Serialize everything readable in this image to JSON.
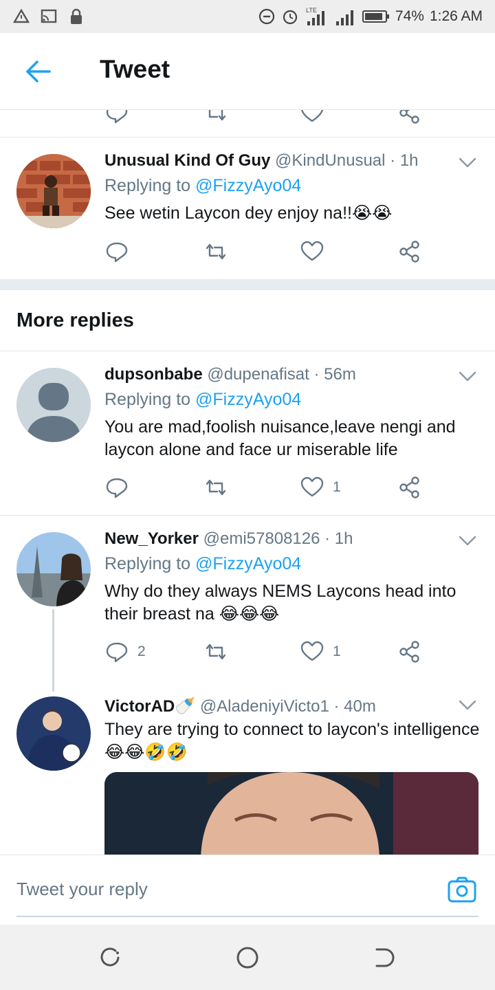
{
  "status_bar": {
    "battery": "74%",
    "time": "1:26 AM",
    "network": "LTE"
  },
  "header": {
    "title": "Tweet"
  },
  "tweets": [
    {
      "name": "Unusual Kind Of Guy",
      "handle": "@KindUnusual",
      "time": "· 1h",
      "replying_prefix": "Replying to",
      "replying_handle": "@FizzyAyo04",
      "text": "See wetin Laycon dey enjoy na!!😭😭",
      "replies": "",
      "likes": ""
    }
  ],
  "section": {
    "title": "More replies"
  },
  "more_replies": [
    {
      "name": "dupsonbabe",
      "handle": "@dupenafisat",
      "time": "· 56m",
      "replying_prefix": "Replying to",
      "replying_handle": "@FizzyAyo04",
      "text": "You are mad,foolish nuisance,leave nengi and laycon alone and face ur miserable life",
      "replies": "",
      "likes": "1"
    },
    {
      "name": "New_Yorker",
      "handle": "@emi57808126",
      "time": "· 1h",
      "replying_prefix": "Replying to",
      "replying_handle": "@FizzyAyo04",
      "text": "Why do they always NEMS Laycons head into their breast na 😂😂😂",
      "replies": "2",
      "likes": "1"
    },
    {
      "name": "VictorAD🍼",
      "handle": "@AladeniyiVicto1",
      "time": "· 40m",
      "text": "They are trying to connect to laycon's intelligence 😂😂🤣🤣"
    }
  ],
  "reply_bar": {
    "placeholder": "Tweet your reply"
  },
  "icons": {
    "accent": "#1da1f2",
    "muted": "#657786"
  }
}
